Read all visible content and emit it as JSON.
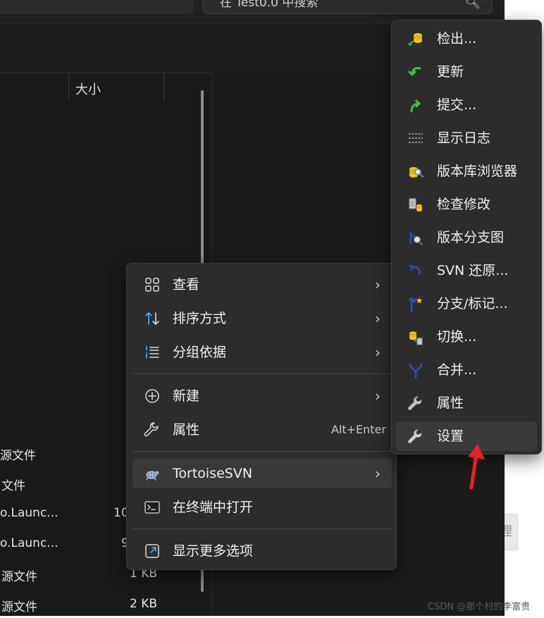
{
  "search": {
    "text": "在 Test0.0 中搜索"
  },
  "columns": {
    "size": "大小"
  },
  "files": [
    {
      "name": "源文件",
      "size": ""
    },
    {
      "name": "文件",
      "size": ""
    },
    {
      "name": "o.Launc...",
      "size": "10"
    },
    {
      "name": "o.Launc...",
      "size": "9"
    },
    {
      "name": "源文件",
      "size": "1 KB"
    },
    {
      "name": "源文件",
      "size": "2 KB"
    }
  ],
  "side_button": {
    "label": "理"
  },
  "context_menu": {
    "view": "查看",
    "sort": "排序方式",
    "group": "分组依据",
    "new": "新建",
    "properties": "属性",
    "properties_accel": "Alt+Enter",
    "tortoise": "TortoiseSVN",
    "terminal": "在终端中打开",
    "more": "显示更多选项"
  },
  "submenu": {
    "checkout": "检出...",
    "update": "更新",
    "commit": "提交...",
    "showlog": "显示日志",
    "repobrowser": "版本库浏览器",
    "checkmods": "检查修改",
    "revgraph": "版本分支图",
    "revert": "SVN 还原...",
    "branch": "分支/标记...",
    "switch": "切换...",
    "merge": "合并...",
    "properties": "属性",
    "settings": "设置"
  },
  "watermark": "CSDN @那个村的李富贵",
  "colors": {
    "menu_bg": "#2c2c2c",
    "highlight": "#393939",
    "annotation_arrow": "#e8202a"
  }
}
